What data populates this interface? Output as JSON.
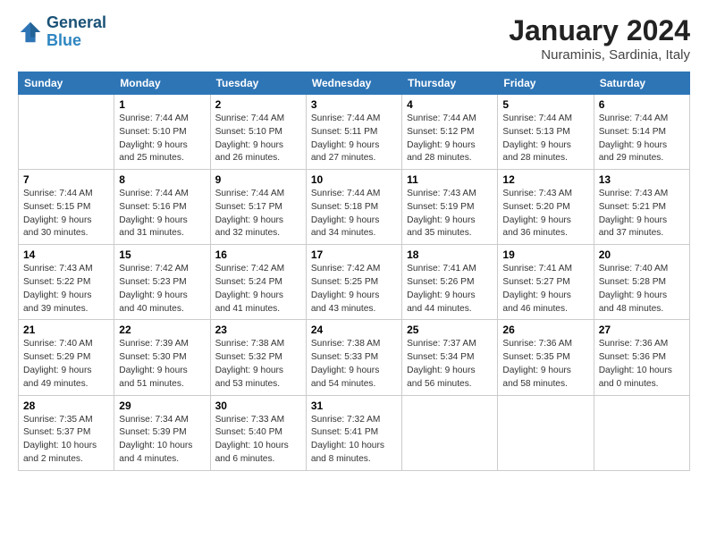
{
  "header": {
    "logo_line1": "General",
    "logo_line2": "Blue",
    "month_year": "January 2024",
    "location": "Nuraminis, Sardinia, Italy"
  },
  "days_of_week": [
    "Sunday",
    "Monday",
    "Tuesday",
    "Wednesday",
    "Thursday",
    "Friday",
    "Saturday"
  ],
  "weeks": [
    [
      {
        "day": "",
        "info": ""
      },
      {
        "day": "1",
        "info": "Sunrise: 7:44 AM\nSunset: 5:10 PM\nDaylight: 9 hours\nand 25 minutes."
      },
      {
        "day": "2",
        "info": "Sunrise: 7:44 AM\nSunset: 5:10 PM\nDaylight: 9 hours\nand 26 minutes."
      },
      {
        "day": "3",
        "info": "Sunrise: 7:44 AM\nSunset: 5:11 PM\nDaylight: 9 hours\nand 27 minutes."
      },
      {
        "day": "4",
        "info": "Sunrise: 7:44 AM\nSunset: 5:12 PM\nDaylight: 9 hours\nand 28 minutes."
      },
      {
        "day": "5",
        "info": "Sunrise: 7:44 AM\nSunset: 5:13 PM\nDaylight: 9 hours\nand 28 minutes."
      },
      {
        "day": "6",
        "info": "Sunrise: 7:44 AM\nSunset: 5:14 PM\nDaylight: 9 hours\nand 29 minutes."
      }
    ],
    [
      {
        "day": "7",
        "info": "Sunrise: 7:44 AM\nSunset: 5:15 PM\nDaylight: 9 hours\nand 30 minutes."
      },
      {
        "day": "8",
        "info": "Sunrise: 7:44 AM\nSunset: 5:16 PM\nDaylight: 9 hours\nand 31 minutes."
      },
      {
        "day": "9",
        "info": "Sunrise: 7:44 AM\nSunset: 5:17 PM\nDaylight: 9 hours\nand 32 minutes."
      },
      {
        "day": "10",
        "info": "Sunrise: 7:44 AM\nSunset: 5:18 PM\nDaylight: 9 hours\nand 34 minutes."
      },
      {
        "day": "11",
        "info": "Sunrise: 7:43 AM\nSunset: 5:19 PM\nDaylight: 9 hours\nand 35 minutes."
      },
      {
        "day": "12",
        "info": "Sunrise: 7:43 AM\nSunset: 5:20 PM\nDaylight: 9 hours\nand 36 minutes."
      },
      {
        "day": "13",
        "info": "Sunrise: 7:43 AM\nSunset: 5:21 PM\nDaylight: 9 hours\nand 37 minutes."
      }
    ],
    [
      {
        "day": "14",
        "info": "Sunrise: 7:43 AM\nSunset: 5:22 PM\nDaylight: 9 hours\nand 39 minutes."
      },
      {
        "day": "15",
        "info": "Sunrise: 7:42 AM\nSunset: 5:23 PM\nDaylight: 9 hours\nand 40 minutes."
      },
      {
        "day": "16",
        "info": "Sunrise: 7:42 AM\nSunset: 5:24 PM\nDaylight: 9 hours\nand 41 minutes."
      },
      {
        "day": "17",
        "info": "Sunrise: 7:42 AM\nSunset: 5:25 PM\nDaylight: 9 hours\nand 43 minutes."
      },
      {
        "day": "18",
        "info": "Sunrise: 7:41 AM\nSunset: 5:26 PM\nDaylight: 9 hours\nand 44 minutes."
      },
      {
        "day": "19",
        "info": "Sunrise: 7:41 AM\nSunset: 5:27 PM\nDaylight: 9 hours\nand 46 minutes."
      },
      {
        "day": "20",
        "info": "Sunrise: 7:40 AM\nSunset: 5:28 PM\nDaylight: 9 hours\nand 48 minutes."
      }
    ],
    [
      {
        "day": "21",
        "info": "Sunrise: 7:40 AM\nSunset: 5:29 PM\nDaylight: 9 hours\nand 49 minutes."
      },
      {
        "day": "22",
        "info": "Sunrise: 7:39 AM\nSunset: 5:30 PM\nDaylight: 9 hours\nand 51 minutes."
      },
      {
        "day": "23",
        "info": "Sunrise: 7:38 AM\nSunset: 5:32 PM\nDaylight: 9 hours\nand 53 minutes."
      },
      {
        "day": "24",
        "info": "Sunrise: 7:38 AM\nSunset: 5:33 PM\nDaylight: 9 hours\nand 54 minutes."
      },
      {
        "day": "25",
        "info": "Sunrise: 7:37 AM\nSunset: 5:34 PM\nDaylight: 9 hours\nand 56 minutes."
      },
      {
        "day": "26",
        "info": "Sunrise: 7:36 AM\nSunset: 5:35 PM\nDaylight: 9 hours\nand 58 minutes."
      },
      {
        "day": "27",
        "info": "Sunrise: 7:36 AM\nSunset: 5:36 PM\nDaylight: 10 hours\nand 0 minutes."
      }
    ],
    [
      {
        "day": "28",
        "info": "Sunrise: 7:35 AM\nSunset: 5:37 PM\nDaylight: 10 hours\nand 2 minutes."
      },
      {
        "day": "29",
        "info": "Sunrise: 7:34 AM\nSunset: 5:39 PM\nDaylight: 10 hours\nand 4 minutes."
      },
      {
        "day": "30",
        "info": "Sunrise: 7:33 AM\nSunset: 5:40 PM\nDaylight: 10 hours\nand 6 minutes."
      },
      {
        "day": "31",
        "info": "Sunrise: 7:32 AM\nSunset: 5:41 PM\nDaylight: 10 hours\nand 8 minutes."
      },
      {
        "day": "",
        "info": ""
      },
      {
        "day": "",
        "info": ""
      },
      {
        "day": "",
        "info": ""
      }
    ]
  ]
}
